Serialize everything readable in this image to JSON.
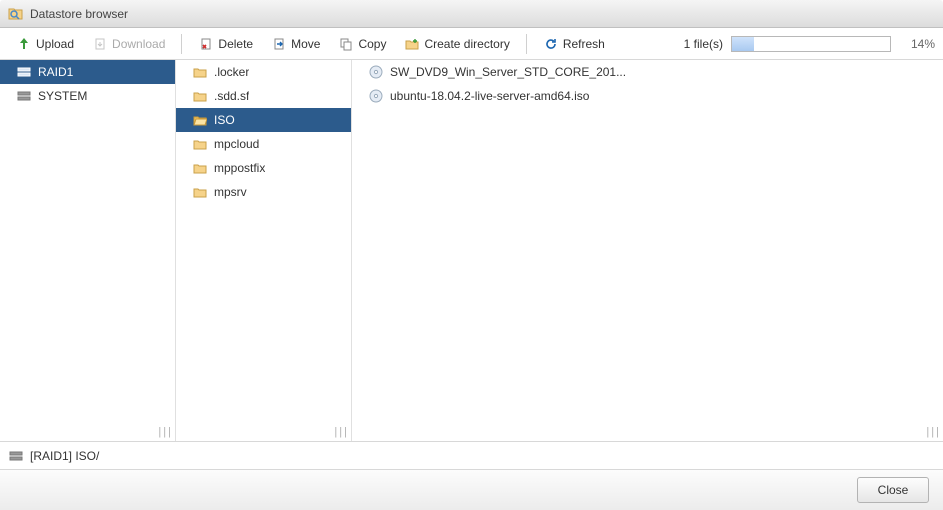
{
  "window": {
    "title": "Datastore browser"
  },
  "toolbar": {
    "upload": "Upload",
    "download": "Download",
    "delete": "Delete",
    "move": "Move",
    "copy": "Copy",
    "create_directory": "Create directory",
    "refresh": "Refresh"
  },
  "progress": {
    "file_count_label": "1 file(s)",
    "percent_label": "14%",
    "percent_value": 14
  },
  "datastores": [
    {
      "name": "RAID1",
      "selected": true
    },
    {
      "name": "SYSTEM",
      "selected": false
    }
  ],
  "folders": [
    {
      "name": ".locker",
      "selected": false
    },
    {
      "name": ".sdd.sf",
      "selected": false
    },
    {
      "name": "ISO",
      "selected": true,
      "open": true
    },
    {
      "name": "mpcloud",
      "selected": false
    },
    {
      "name": "mppostfix",
      "selected": false
    },
    {
      "name": "mpsrv",
      "selected": false
    }
  ],
  "files": [
    {
      "name": "SW_DVD9_Win_Server_STD_CORE_201..."
    },
    {
      "name": "ubuntu-18.04.2-live-server-amd64.iso"
    }
  ],
  "path": "[RAID1] ISO/",
  "footer": {
    "close": "Close"
  }
}
